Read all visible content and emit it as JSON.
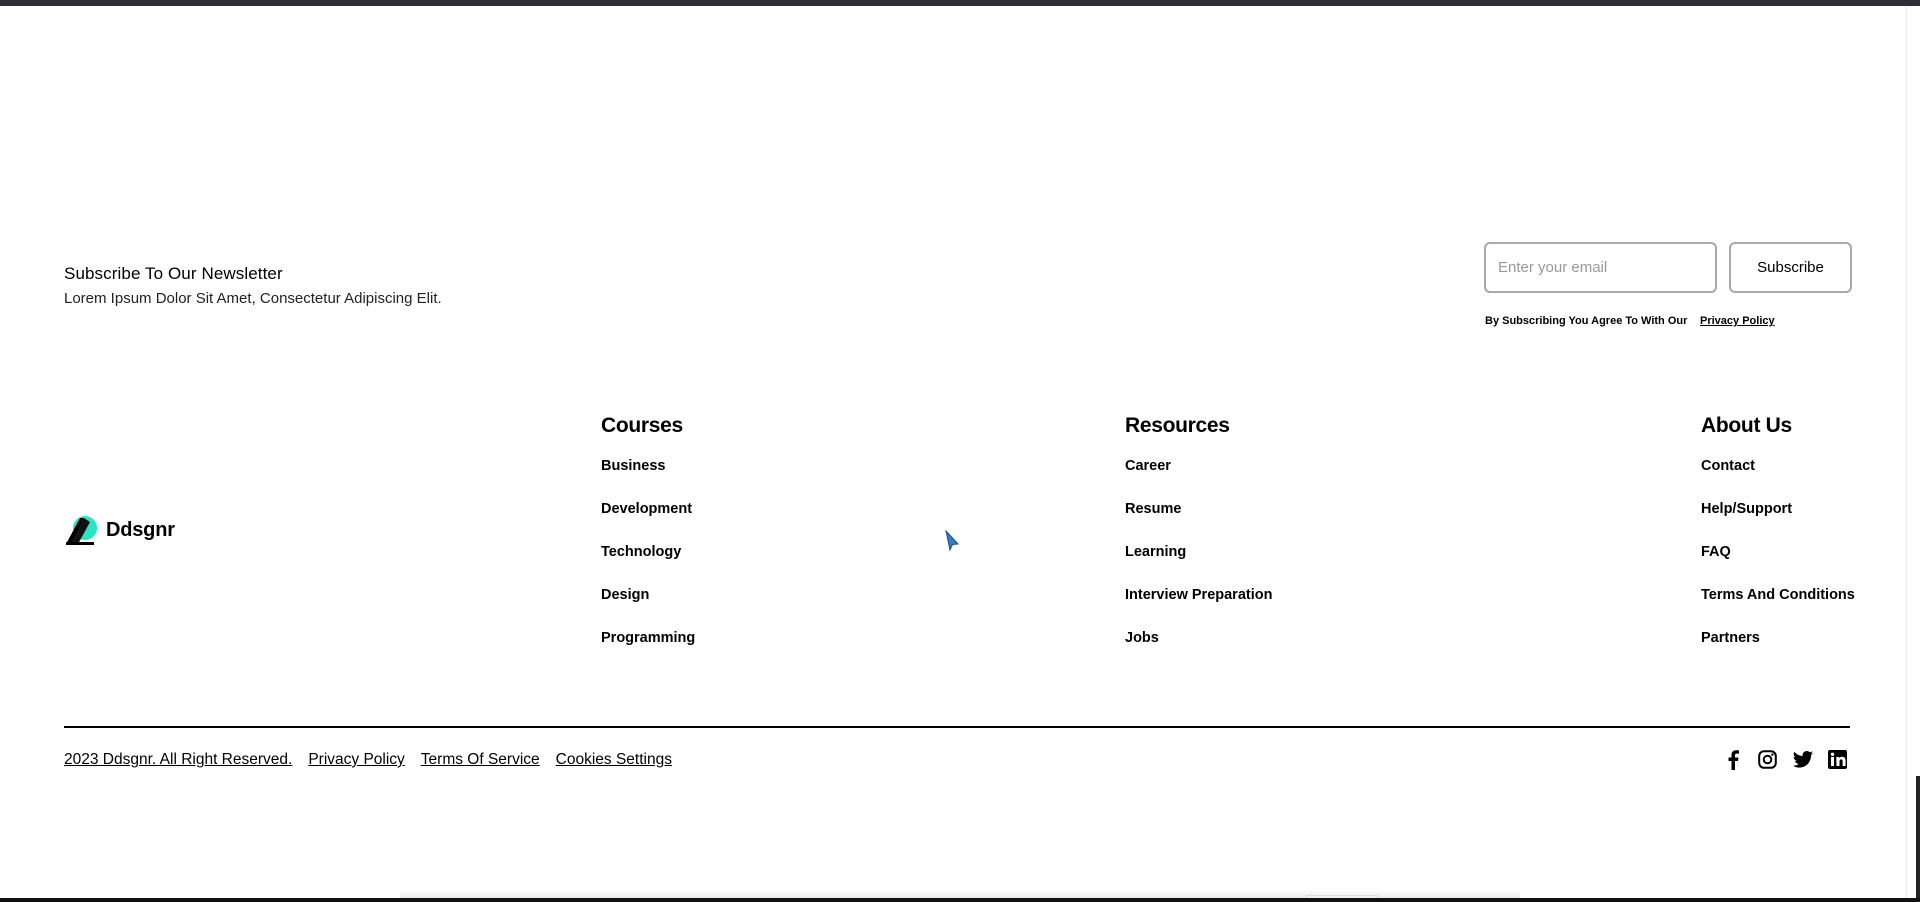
{
  "newsletter": {
    "title": "Subscribe To Our Newsletter",
    "description": "Lorem Ipsum Dolor Sit Amet, Consectetur Adipiscing Elit.",
    "email_placeholder": "Enter your email",
    "subscribe_label": "Subscribe",
    "agree_text": "By Subscribing You Agree To With Our",
    "privacy_link": "Privacy Policy"
  },
  "brand": {
    "name": "Ddsgnr",
    "accent_color": "#2de3c2"
  },
  "columns": [
    {
      "heading": "Courses",
      "items": [
        "Business",
        "Development",
        "Technology",
        "Design",
        "Programming"
      ]
    },
    {
      "heading": "Resources",
      "items": [
        "Career",
        "Resume",
        "Learning",
        "Interview Preparation",
        "Jobs"
      ]
    },
    {
      "heading": "About Us",
      "items": [
        "Contact",
        "Help/Support",
        "FAQ",
        "Terms And Conditions",
        "Partners"
      ]
    }
  ],
  "footer": {
    "copyright": "2023 Ddsgnr. All Right Reserved.",
    "links": [
      "Privacy Policy",
      "Terms Of Service",
      "Cookies Settings"
    ],
    "social_icons": [
      "facebook-icon",
      "instagram-icon",
      "twitter-icon",
      "linkedin-icon"
    ]
  }
}
